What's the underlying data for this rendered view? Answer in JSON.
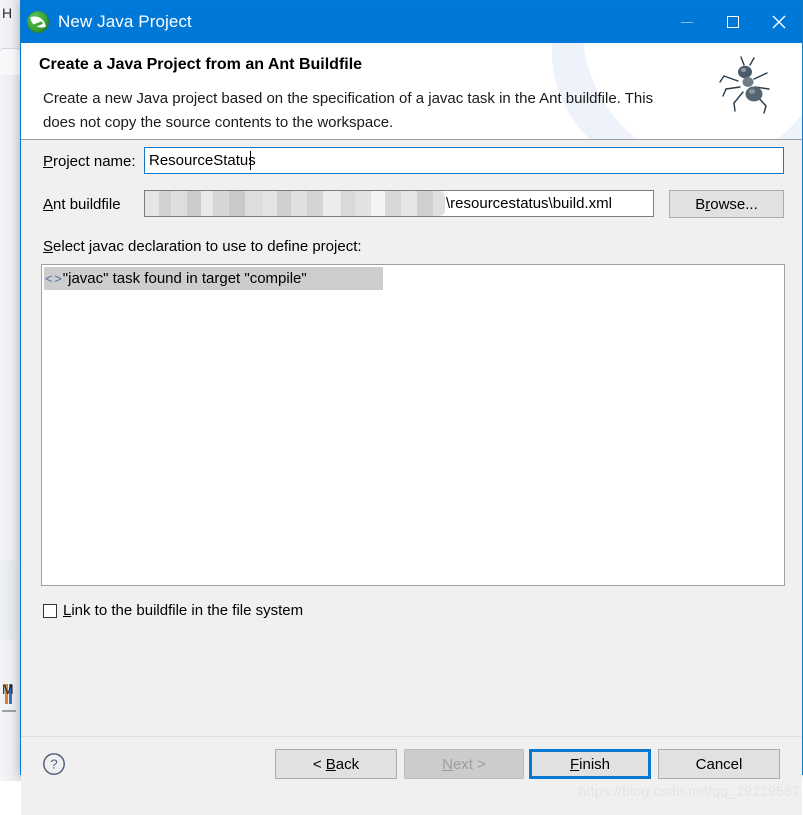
{
  "background": {
    "letter_top": "H",
    "letter_bottom": "M"
  },
  "window": {
    "title": "New Java Project",
    "app_icon": "spring-leaf-icon",
    "controls": {
      "minimize": "minimize-icon",
      "maximize": "maximize-icon",
      "close": "close-icon"
    }
  },
  "banner": {
    "title": "Create a Java Project from an Ant Buildfile",
    "description": "Create a new Java project based on the specification of a javac task in the Ant buildfile. This does not copy the source contents to the workspace.",
    "icon": "ant-icon"
  },
  "form": {
    "project_name_label": "Project name:",
    "project_name_value": "ResourceStatus",
    "buildfile_label": "Ant buildfile",
    "buildfile_value_visible": "\\resourcestatus\\build.xml",
    "buildfile_value_redacted": "(path redacted / pixelated)",
    "browse_label": "Browse...",
    "select_label": "Select javac declaration to use to define project:"
  },
  "list": {
    "items": [
      {
        "icon": "xml-tag-icon",
        "icon_glyph": "< >",
        "label": "\"javac\" task found in target \"compile\"",
        "selected": true
      }
    ]
  },
  "checkbox": {
    "label": "Link to the buildfile in the file system",
    "checked": false
  },
  "footer": {
    "help_icon": "help-icon",
    "back_label": "< Back",
    "next_label": "Next >",
    "finish_label": "Finish",
    "cancel_label": "Cancel",
    "next_enabled": false,
    "finish_default": true,
    "watermark": "https://blog.csdn.net/qq_29229567"
  },
  "colors": {
    "titlebar": "#0078d7",
    "focus_border": "#0a7ad1",
    "dialog_bg": "#f0f0f0",
    "button_face": "#e1e1e1",
    "selection": "#cdcdcd"
  }
}
